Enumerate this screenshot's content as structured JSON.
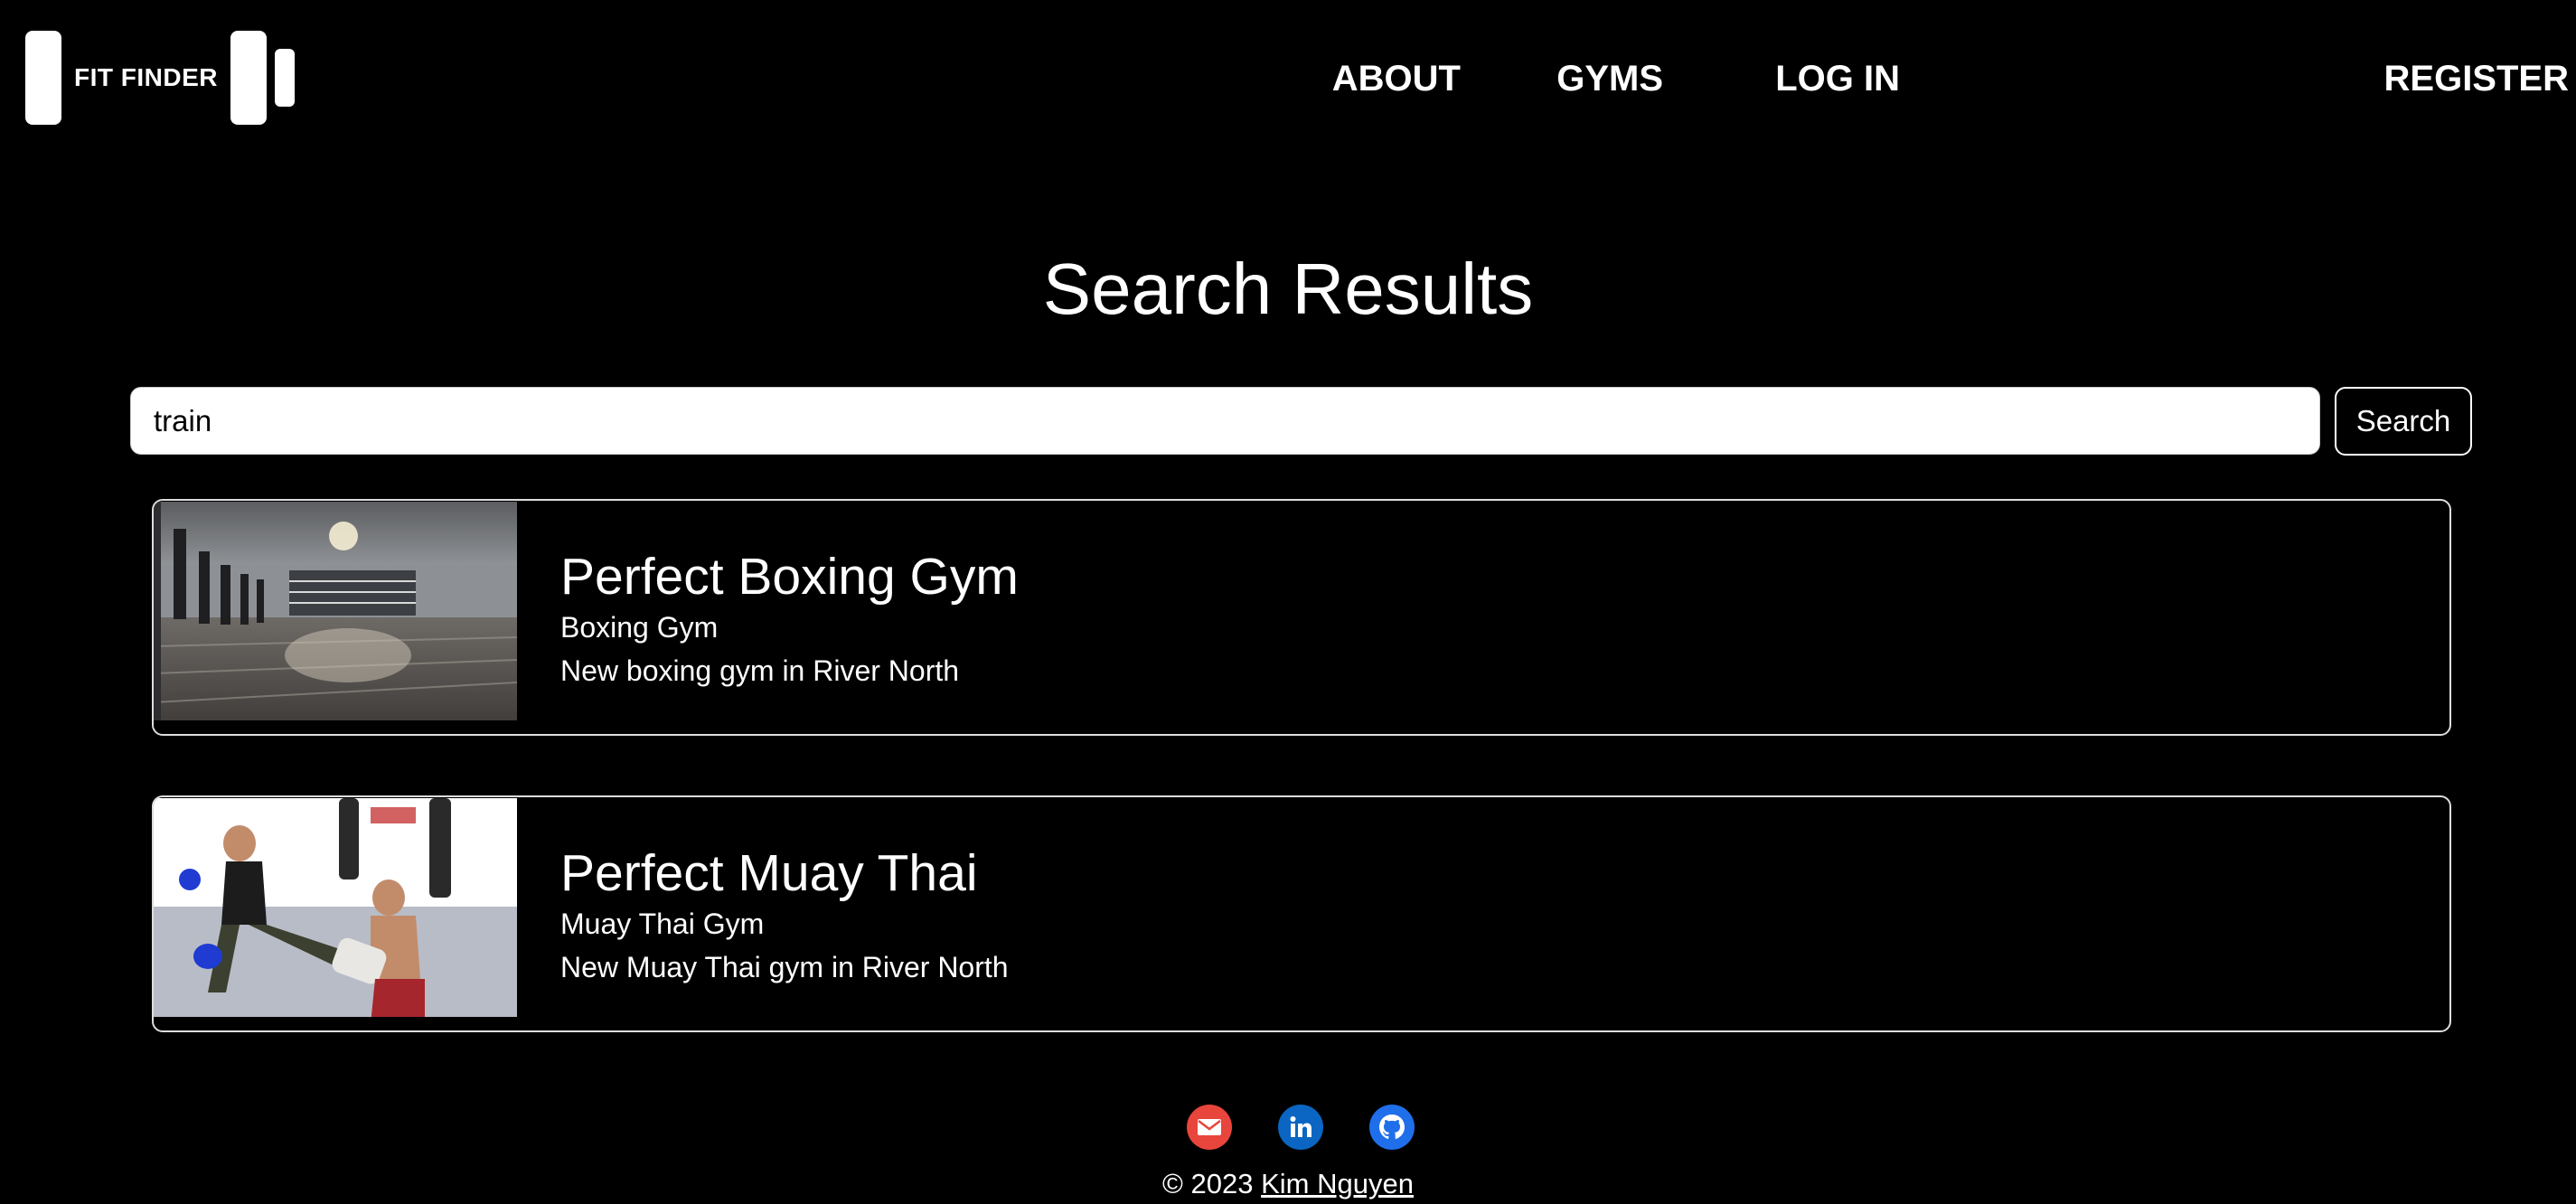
{
  "header": {
    "logo_text": "FIT FINDER",
    "nav": [
      {
        "label": "ABOUT"
      },
      {
        "label": "GYMS"
      },
      {
        "label": "LOG IN"
      },
      {
        "label": "REGISTER"
      }
    ]
  },
  "main": {
    "title": "Search Results",
    "search": {
      "value": "train",
      "button_label": "Search"
    },
    "results": [
      {
        "name": "Perfect Boxing Gym",
        "type": "Boxing Gym",
        "description": "New boxing gym in River North"
      },
      {
        "name": "Perfect Muay Thai",
        "type": "Muay Thai Gym",
        "description": "New Muay Thai gym in River North"
      }
    ]
  },
  "footer": {
    "social": [
      {
        "icon": "email-icon",
        "color": "#e8453c"
      },
      {
        "icon": "linkedin-icon",
        "color": "#0a66c2"
      },
      {
        "icon": "github-icon",
        "color": "#1f6feb"
      }
    ],
    "copyright_prefix": "© 2023",
    "author_link": "Kim Nguyen"
  }
}
